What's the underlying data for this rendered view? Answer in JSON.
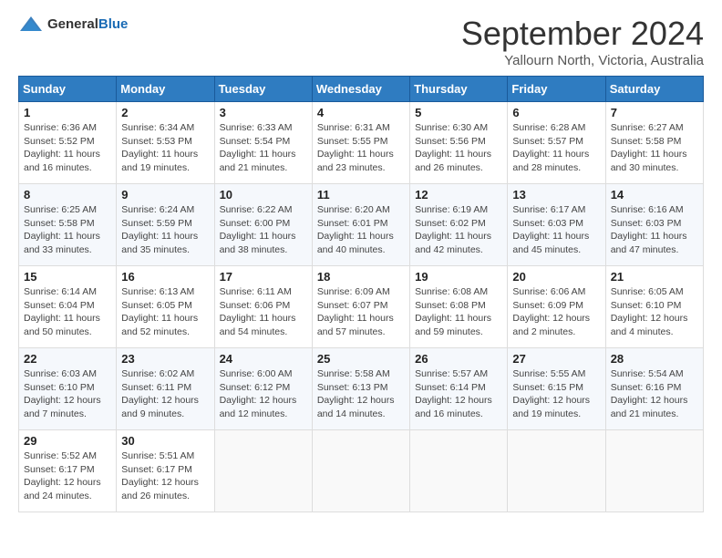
{
  "header": {
    "logo": {
      "text_general": "General",
      "text_blue": "Blue"
    },
    "title": "September 2024",
    "location": "Yallourn North, Victoria, Australia"
  },
  "calendar": {
    "days_of_week": [
      "Sunday",
      "Monday",
      "Tuesday",
      "Wednesday",
      "Thursday",
      "Friday",
      "Saturday"
    ],
    "weeks": [
      [
        {
          "day": "1",
          "sunrise": "6:36 AM",
          "sunset": "5:52 PM",
          "daylight": "11 hours and 16 minutes."
        },
        {
          "day": "2",
          "sunrise": "6:34 AM",
          "sunset": "5:53 PM",
          "daylight": "11 hours and 19 minutes."
        },
        {
          "day": "3",
          "sunrise": "6:33 AM",
          "sunset": "5:54 PM",
          "daylight": "11 hours and 21 minutes."
        },
        {
          "day": "4",
          "sunrise": "6:31 AM",
          "sunset": "5:55 PM",
          "daylight": "11 hours and 23 minutes."
        },
        {
          "day": "5",
          "sunrise": "6:30 AM",
          "sunset": "5:56 PM",
          "daylight": "11 hours and 26 minutes."
        },
        {
          "day": "6",
          "sunrise": "6:28 AM",
          "sunset": "5:57 PM",
          "daylight": "11 hours and 28 minutes."
        },
        {
          "day": "7",
          "sunrise": "6:27 AM",
          "sunset": "5:58 PM",
          "daylight": "11 hours and 30 minutes."
        }
      ],
      [
        {
          "day": "8",
          "sunrise": "6:25 AM",
          "sunset": "5:58 PM",
          "daylight": "11 hours and 33 minutes."
        },
        {
          "day": "9",
          "sunrise": "6:24 AM",
          "sunset": "5:59 PM",
          "daylight": "11 hours and 35 minutes."
        },
        {
          "day": "10",
          "sunrise": "6:22 AM",
          "sunset": "6:00 PM",
          "daylight": "11 hours and 38 minutes."
        },
        {
          "day": "11",
          "sunrise": "6:20 AM",
          "sunset": "6:01 PM",
          "daylight": "11 hours and 40 minutes."
        },
        {
          "day": "12",
          "sunrise": "6:19 AM",
          "sunset": "6:02 PM",
          "daylight": "11 hours and 42 minutes."
        },
        {
          "day": "13",
          "sunrise": "6:17 AM",
          "sunset": "6:03 PM",
          "daylight": "11 hours and 45 minutes."
        },
        {
          "day": "14",
          "sunrise": "6:16 AM",
          "sunset": "6:03 PM",
          "daylight": "11 hours and 47 minutes."
        }
      ],
      [
        {
          "day": "15",
          "sunrise": "6:14 AM",
          "sunset": "6:04 PM",
          "daylight": "11 hours and 50 minutes."
        },
        {
          "day": "16",
          "sunrise": "6:13 AM",
          "sunset": "6:05 PM",
          "daylight": "11 hours and 52 minutes."
        },
        {
          "day": "17",
          "sunrise": "6:11 AM",
          "sunset": "6:06 PM",
          "daylight": "11 hours and 54 minutes."
        },
        {
          "day": "18",
          "sunrise": "6:09 AM",
          "sunset": "6:07 PM",
          "daylight": "11 hours and 57 minutes."
        },
        {
          "day": "19",
          "sunrise": "6:08 AM",
          "sunset": "6:08 PM",
          "daylight": "11 hours and 59 minutes."
        },
        {
          "day": "20",
          "sunrise": "6:06 AM",
          "sunset": "6:09 PM",
          "daylight": "12 hours and 2 minutes."
        },
        {
          "day": "21",
          "sunrise": "6:05 AM",
          "sunset": "6:10 PM",
          "daylight": "12 hours and 4 minutes."
        }
      ],
      [
        {
          "day": "22",
          "sunrise": "6:03 AM",
          "sunset": "6:10 PM",
          "daylight": "12 hours and 7 minutes."
        },
        {
          "day": "23",
          "sunrise": "6:02 AM",
          "sunset": "6:11 PM",
          "daylight": "12 hours and 9 minutes."
        },
        {
          "day": "24",
          "sunrise": "6:00 AM",
          "sunset": "6:12 PM",
          "daylight": "12 hours and 12 minutes."
        },
        {
          "day": "25",
          "sunrise": "5:58 AM",
          "sunset": "6:13 PM",
          "daylight": "12 hours and 14 minutes."
        },
        {
          "day": "26",
          "sunrise": "5:57 AM",
          "sunset": "6:14 PM",
          "daylight": "12 hours and 16 minutes."
        },
        {
          "day": "27",
          "sunrise": "5:55 AM",
          "sunset": "6:15 PM",
          "daylight": "12 hours and 19 minutes."
        },
        {
          "day": "28",
          "sunrise": "5:54 AM",
          "sunset": "6:16 PM",
          "daylight": "12 hours and 21 minutes."
        }
      ],
      [
        {
          "day": "29",
          "sunrise": "5:52 AM",
          "sunset": "6:17 PM",
          "daylight": "12 hours and 24 minutes."
        },
        {
          "day": "30",
          "sunrise": "5:51 AM",
          "sunset": "6:17 PM",
          "daylight": "12 hours and 26 minutes."
        },
        null,
        null,
        null,
        null,
        null
      ]
    ]
  }
}
